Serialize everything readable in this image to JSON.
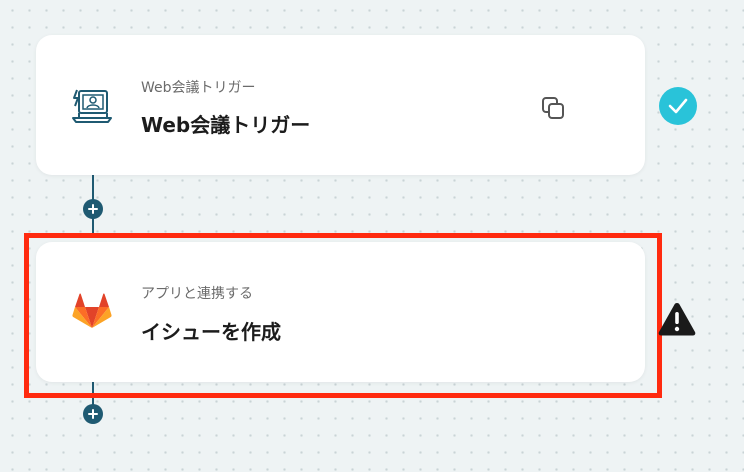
{
  "flow": {
    "steps": [
      {
        "label": "Web会議トリガー",
        "title": "Web会議トリガー",
        "icon": "web-meeting-icon",
        "status": "complete",
        "status_icon": "check-icon"
      },
      {
        "label": "アプリと連携する",
        "title": "イシューを作成",
        "icon": "gitlab-icon",
        "status": "warning",
        "status_icon": "warning-icon"
      }
    ],
    "add_step_icon": "plus-icon"
  },
  "colors": {
    "connector": "#1f5a72",
    "success": "#29c3d9",
    "highlight": "#ff2a0f",
    "warning": "#1a1a1a"
  }
}
